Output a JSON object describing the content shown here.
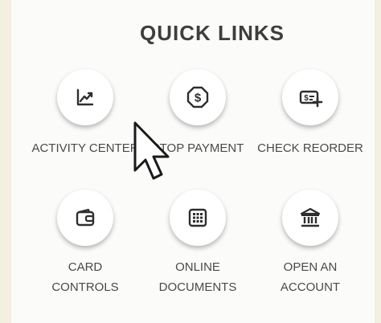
{
  "header": {
    "title": "QUICK LINKS"
  },
  "links": [
    {
      "label": "ACTIVITY CENTER",
      "icon": "chart-icon"
    },
    {
      "label": "STOP PAYMENT",
      "icon": "dollar-octagon-icon"
    },
    {
      "label": "CHECK REORDER",
      "icon": "check-plus-icon"
    },
    {
      "label_line1": "CARD",
      "label_line2": "CONTROLS",
      "icon": "wallet-icon"
    },
    {
      "label_line1": "ONLINE",
      "label_line2": "DOCUMENTS",
      "icon": "document-grid-icon"
    },
    {
      "label_line1": "OPEN AN",
      "label_line2": "ACCOUNT",
      "icon": "bank-icon"
    }
  ],
  "colors": {
    "background": "#f3efe1",
    "panel": "#fbfbfa",
    "text": "#3e3e3e",
    "icon": "#2e2e2e"
  }
}
